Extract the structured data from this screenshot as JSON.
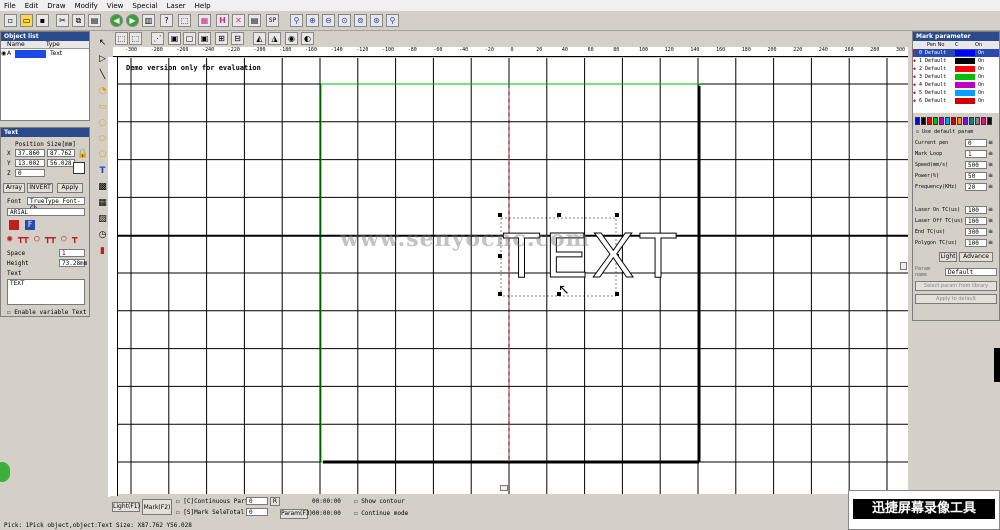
{
  "menu": [
    "File",
    "Edit",
    "Draw",
    "Modify",
    "View",
    "Special",
    "Laser",
    "Help"
  ],
  "object_list": {
    "title": "Object list",
    "col_name": "Name",
    "col_type": "Type",
    "row_name": "A",
    "row_type": "Text"
  },
  "text_panel": {
    "title": "Text",
    "col_position": "Position",
    "col_size": "Size[mm]",
    "x_label": "X",
    "y_label": "Y",
    "z_label": "Z",
    "x_pos": "37.860",
    "x_size": "87.762",
    "y_pos": "13.002",
    "y_size": "56.028",
    "z_pos": "0",
    "array_label": "Array",
    "invert_label": "INVERT",
    "apply_label": "Apply",
    "font_label": "Font",
    "font_value": "TrueType Font-Ch",
    "font_name": "ARIAL",
    "space_label": "Space",
    "space_value": "1",
    "height_label": "Height",
    "height_value": "73.28mm",
    "text_label": "Text",
    "text_value": "TEXT",
    "variable_label": "Enable variable Text"
  },
  "canvas": {
    "demo_text": "Demo version only for evaluation",
    "ruler_top": [
      "-300",
      "-280",
      "-260",
      "-240",
      "-220",
      "-200",
      "-180",
      "-160",
      "-140",
      "-120",
      "-100",
      "-80",
      "-60",
      "-40",
      "-20",
      "0",
      "20",
      "40",
      "60",
      "80",
      "100",
      "120",
      "140",
      "160",
      "180",
      "200",
      "220",
      "240",
      "260",
      "280",
      "300"
    ],
    "object_text": "TEXT",
    "watermark": "www.senyocnc.com"
  },
  "mark_param": {
    "title": "Mark parameter",
    "col_pen": "Pen No",
    "col_c": "C",
    "col_on": "On",
    "pens": [
      {
        "no": "0",
        "name": "Default",
        "color": "#0000ff",
        "on": "On"
      },
      {
        "no": "1",
        "name": "Default",
        "color": "#000000",
        "on": "On"
      },
      {
        "no": "2",
        "name": "Default",
        "color": "#ff0000",
        "on": "On"
      },
      {
        "no": "3",
        "name": "Default",
        "color": "#00c000",
        "on": "On"
      },
      {
        "no": "4",
        "name": "Default",
        "color": "#c000c0",
        "on": "On"
      },
      {
        "no": "5",
        "name": "Default",
        "color": "#00a0ff",
        "on": "On"
      },
      {
        "no": "6",
        "name": "Default",
        "color": "#d00000",
        "on": "On"
      }
    ],
    "palette": [
      "#0000ff",
      "#000000",
      "#ff0000",
      "#00c000",
      "#c000c0",
      "#00a0ff",
      "#d00000",
      "#ff8800",
      "#8800ff",
      "#008888",
      "#888888",
      "#ff0088",
      "#111111"
    ],
    "use_default": "Use default param",
    "rows": [
      {
        "label": "Current pen",
        "value": "0"
      },
      {
        "label": "Mark Loop",
        "value": "1"
      },
      {
        "label": "Speed(mm/s)",
        "value": "500"
      },
      {
        "label": "Power(%)",
        "value": "50"
      },
      {
        "label": "Frequency(KHz)",
        "value": "20"
      },
      {
        "label": "Laser On TC(us)",
        "value": "100"
      },
      {
        "label": "Laser Off TC(us)",
        "value": "100"
      },
      {
        "label": "End TC(us)",
        "value": "300"
      },
      {
        "label": "Polygon TC(us)",
        "value": "100"
      }
    ],
    "btn_1": "Light",
    "btn_2": "Advance",
    "param_name_label": "Param name",
    "param_name_value": "Default",
    "select_param": "Select param from library",
    "apply_default": "Apply to default"
  },
  "bottom": {
    "light": "Light(F1)",
    "mark": "Mark(F2)",
    "continuous": "[C]Continuous Part",
    "part_value": "0",
    "mark_sele": "[S]Mark Sele",
    "total_label": "Total",
    "total_value": "0",
    "time_1": "00:00:00",
    "time_2": "00:00:00",
    "param_btn": "Param(F3)",
    "show_contour": "Show contour",
    "continue_mode": "Continue mode"
  },
  "status_text": "Pick: 1Pick object,object:Text Size: X87.762 Y56.028",
  "overlay_text": "迅捷屏幕录像工具"
}
